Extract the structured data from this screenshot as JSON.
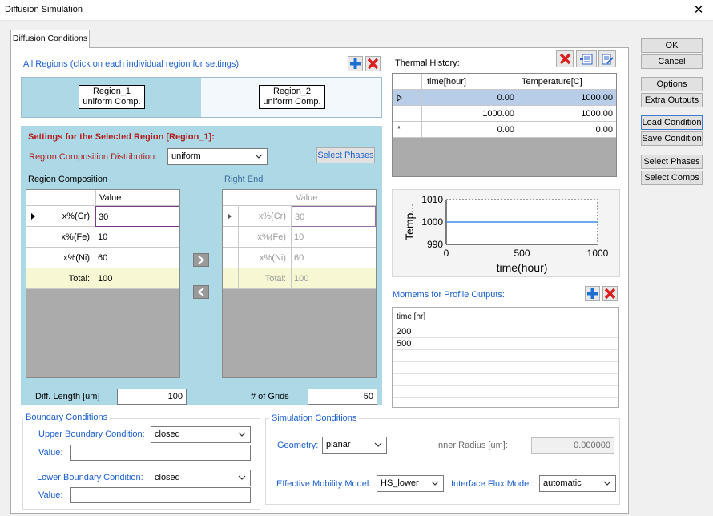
{
  "window": {
    "title": "Diffusion Simulation",
    "close_glyph": "✕"
  },
  "tab": {
    "label": "Diffusion Conditions"
  },
  "regions": {
    "header": "All Regions (click on each individual region for settings):",
    "items": [
      {
        "line1": "Region_1",
        "line2": "uniform Comp."
      },
      {
        "line1": "Region_2",
        "line2": "uniform Comp."
      }
    ],
    "add_icon": "plus-icon",
    "delete_icon": "red-x-icon"
  },
  "settings": {
    "title": "Settings for the Selected Region [Region_1]:",
    "distribution_label": "Region Composition Distribution:",
    "distribution_value": "uniform",
    "select_phases_label": "Select Phases",
    "composition_label": "Region Composition",
    "right_end_label": "Right End",
    "value_header": "Value",
    "rows": [
      {
        "label": "x%(Cr)",
        "value": "30"
      },
      {
        "label": "x%(Fe)",
        "value": "10"
      },
      {
        "label": "x%(Ni)",
        "value": "60"
      }
    ],
    "total_label": "Total:",
    "total_value": "100",
    "diff_length_label": "Diff. Length [um]",
    "diff_length_value": "100",
    "grids_label": "# of Grids",
    "grids_value": "50"
  },
  "thermal": {
    "label": "Thermal History:",
    "col_time": "time[hour]",
    "col_temp": "Temperature[C]",
    "rows": [
      {
        "time": "0.00",
        "temp": "1000.00"
      },
      {
        "time": "1000.00",
        "temp": "1000.00"
      },
      {
        "time": "0.00",
        "temp": "0.00"
      }
    ],
    "new_row_marker": "*"
  },
  "chart_data": {
    "type": "line",
    "xlabel": "time(hour)",
    "ylabel": "Temp...",
    "xlim": [
      0,
      1000
    ],
    "ylim": [
      990,
      1010
    ],
    "x_ticks": [
      "0",
      "500",
      "1000"
    ],
    "y_ticks": [
      "990",
      "1000",
      "1010"
    ],
    "series": [
      {
        "x": [
          0,
          1000
        ],
        "y": [
          1000,
          1000
        ],
        "color": "#3d8ee8"
      }
    ]
  },
  "moments": {
    "label": "Momems for Profile Outputs:",
    "header": "time [hr]",
    "items": [
      "200",
      "500"
    ]
  },
  "boundary": {
    "title": "Boundary Conditions",
    "upper_label": "Upper Boundary Condition:",
    "upper_value": "closed",
    "lower_label": "Lower Boundary Condition:",
    "lower_value": "closed",
    "value_label": "Value:"
  },
  "simulation": {
    "title": "Simulation Conditions",
    "geometry_label": "Geometry:",
    "geometry_value": "planar",
    "inner_radius_label": "Inner Radius [um]:",
    "inner_radius_value": "0.000000",
    "mobility_label": "Effective Mobility Model:",
    "mobility_value": "HS_lower",
    "flux_label": "Interface Flux Model:",
    "flux_value": "automatic"
  },
  "side_buttons": {
    "ok": "OK",
    "cancel": "Cancel",
    "options": "Options",
    "extra_outputs": "Extra Outputs",
    "load_condition": "Load Condition",
    "save_condition": "Save Condition",
    "select_phases": "Select Phases",
    "select_comps": "Select Comps"
  },
  "colors": {
    "region_selected": "#add8e6",
    "settings_bg": "#add8e6",
    "accent_blue": "#1a5fd0",
    "label_red": "#b02020",
    "total_row": "#f7f7d4",
    "selected_row": "#b8cde8"
  }
}
